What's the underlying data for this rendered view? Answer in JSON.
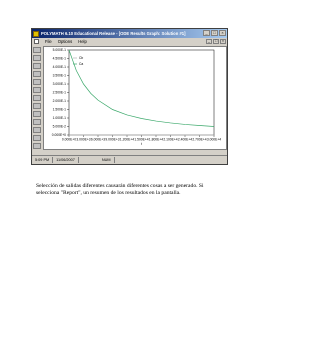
{
  "window": {
    "title": "POLYMATH 6.10 Educational Release - [ODE Results Graph: Solution #1]",
    "menu": [
      "File",
      "Options",
      "Help"
    ],
    "controls": [
      "minimize-icon",
      "maximize-icon",
      "close-icon"
    ]
  },
  "toolbar": {
    "icons": [
      "open-icon",
      "save-icon",
      "print-icon",
      "copy-icon",
      "graph-icon",
      "table-icon",
      "zoom-icon",
      "settings-icon",
      "legend-icon",
      "color-icon",
      "export-icon",
      "help-icon",
      "refresh-icon"
    ]
  },
  "status": {
    "time": "5:09 PM",
    "date": "11/06/2007",
    "mode": "NUM"
  },
  "caption": "Selección de salidas diferentes causarán diferentes cosas a ser generado. Si selecciona \"Report\", un resumen de los resultados en la pantalla.",
  "chart_data": {
    "type": "line",
    "title": "",
    "xlabel": "t",
    "ylabel": "",
    "xlim": [
      0,
      30000
    ],
    "ylim": [
      0,
      0.5
    ],
    "x_ticks": [
      "0.000E+0",
      "3.000E+3",
      "6.000E+3",
      "9.000E+3",
      "1.200E+4",
      "1.500E+4",
      "1.800E+4",
      "2.100E+4",
      "2.400E+4",
      "2.700E+4",
      "3.000E+4"
    ],
    "y_ticks": [
      "5.000E-1",
      "4.500E-1",
      "4.000E-1",
      "3.500E-1",
      "3.000E-1",
      "2.500E-1",
      "2.000E-1",
      "1.500E-1",
      "1.000E-1",
      "5.000E-2",
      "0.000E+0"
    ],
    "legend": [
      "Cb",
      "Ca"
    ],
    "legend_placement": "top-left",
    "series": [
      {
        "name": "Cb",
        "color": "#b0b0b0",
        "x": [
          0,
          3000,
          6000,
          9000,
          12000,
          15000,
          18000,
          21000,
          24000,
          27000,
          30000
        ],
        "y": [
          0,
          0,
          0,
          0,
          0,
          0,
          0,
          0,
          0,
          0,
          0
        ]
      },
      {
        "name": "Ca",
        "color": "#3aa86a",
        "x": [
          0,
          1500,
          3000,
          4500,
          6000,
          9000,
          12000,
          15000,
          18000,
          21000,
          24000,
          27000,
          30000
        ],
        "y": [
          0.5,
          0.38,
          0.3,
          0.245,
          0.205,
          0.15,
          0.118,
          0.097,
          0.082,
          0.071,
          0.062,
          0.056,
          0.05
        ]
      }
    ]
  }
}
